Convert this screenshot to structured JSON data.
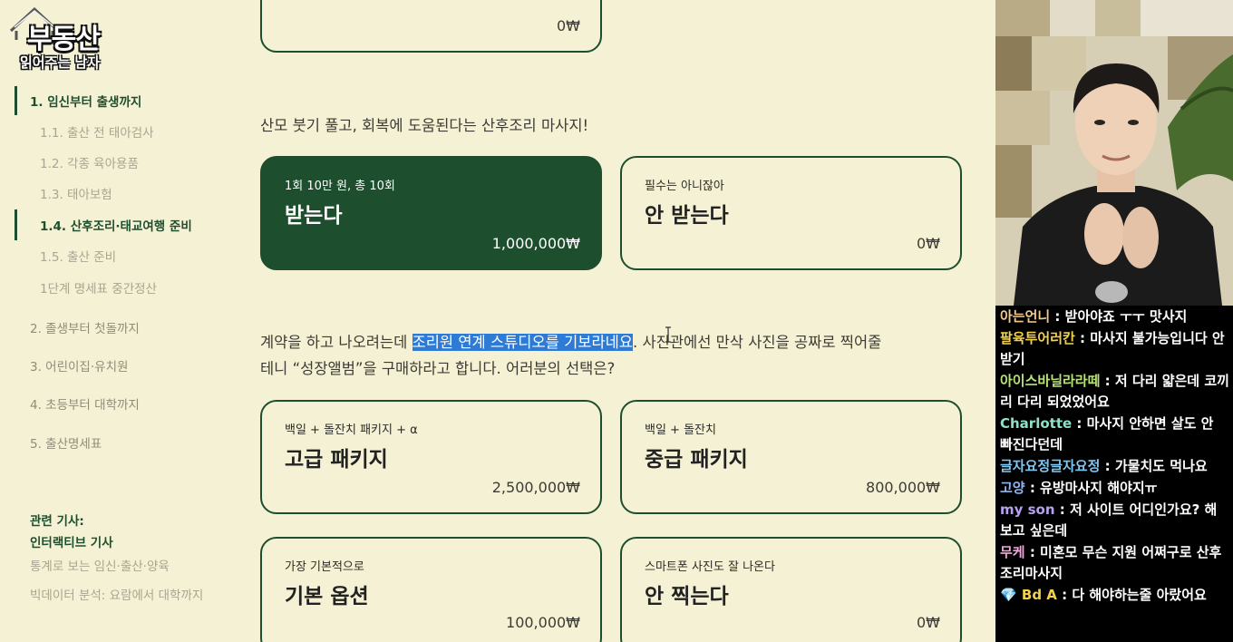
{
  "logo": {
    "line1": "부동산",
    "line2": "읽어주는 남자"
  },
  "nav": {
    "items": [
      {
        "label": "1. 임신부터 출생까지",
        "level": "main",
        "active": true
      },
      {
        "label": "1.1. 출산 전 태아검사",
        "level": "sub",
        "active": false
      },
      {
        "label": "1.2. 각종 육아용품",
        "level": "sub",
        "active": false
      },
      {
        "label": "1.3. 태아보험",
        "level": "sub",
        "active": false
      },
      {
        "label": "1.4. 산후조리·태교여행 준비",
        "level": "sub",
        "active": true
      },
      {
        "label": "1.5. 출산 준비",
        "level": "sub",
        "active": false
      },
      {
        "label": "1단계 명세표 중간정산",
        "level": "sub",
        "active": false
      },
      {
        "label": "2. 졸생부터 첫돌까지",
        "level": "main",
        "active": false
      },
      {
        "label": "3. 어린이집·유치원",
        "level": "main",
        "active": false
      },
      {
        "label": "4. 초등부터 대학까지",
        "level": "main",
        "active": false
      },
      {
        "label": "5. 출산명세표",
        "level": "main",
        "active": false
      }
    ]
  },
  "related": {
    "title": "관련 기사:",
    "links": [
      "인터랙티브 기사",
      "통계로 보는 임신·출산·양육",
      "빅데이터 분석: 요람에서 대학까지"
    ]
  },
  "top_card": {
    "price": "0₩"
  },
  "question1": {
    "text": "산모 붓기 풀고, 회복에 도움된다는 산후조리 마사지!"
  },
  "cards1": [
    {
      "sub": "1회 10만 원, 총 10회",
      "title": "받는다",
      "price": "1,000,000₩",
      "selected": true
    },
    {
      "sub": "필수는 아니잖아",
      "title": "안 받는다",
      "price": "0₩",
      "selected": false
    }
  ],
  "question2": {
    "before": "계약을 하고 나오려는데 ",
    "highlight": "조리원 연계 스튜디오를 기보라네요",
    "after": ". 사진관에선 만삭 사진을 공짜로 찍어줄",
    "line2": "테니 “성장앨범”을 구매하라고 합니다. 어러분의 선택은?"
  },
  "cards2": [
    {
      "sub": "백일 + 돌잔치 패키지 + α",
      "title": "고급 패키지",
      "price": "2,500,000₩",
      "selected": false
    },
    {
      "sub": "백일 + 돌잔치",
      "title": "중급 패키지",
      "price": "800,000₩",
      "selected": false
    },
    {
      "sub": "가장 기본적으로",
      "title": "기본 옵션",
      "price": "100,000₩",
      "selected": false
    },
    {
      "sub": "스마트폰 사진도 잘 나온다",
      "title": "안 찍는다",
      "price": "0₩",
      "selected": false
    }
  ],
  "chat": {
    "messages": [
      {
        "user": "아는언니",
        "text": " : 받아야죠 ㅜㅜ 맛사지",
        "color": "#f5c98a"
      },
      {
        "user": "팔육투어러칸",
        "text": " : 마사지 불가능입니다 안받기",
        "color": "#f3d24a"
      },
      {
        "user": "아이스바닐라라떼",
        "text": " : 저 다리 얇은데 코끼리 다리 되었었어요",
        "color": "#b6e37a"
      },
      {
        "user": "Charlotte",
        "text": " : 마사지 안하면 살도 안 빠진다던데",
        "color": "#8fe0c8"
      },
      {
        "user": "글자요정글자요정",
        "text": " : 가물치도 먹나요",
        "color": "#7fc6f0"
      },
      {
        "user": "고양",
        "text": " : 유방마사지 해야지ㅠ",
        "color": "#8fb6f5"
      },
      {
        "user": "my son",
        "text": " : 저 사이트 어디인가요? 해보고 싶은데",
        "color": "#b8a0f0"
      },
      {
        "user": "무케",
        "text": " : 미혼모 무슨 지원 어쩌구로 산후조리마사지",
        "color": "#f0a6d8"
      },
      {
        "user": "💎 Bd A",
        "text": " : 다 해야하는줄 아랐어요",
        "color": "#f3d24a"
      }
    ]
  },
  "colors": {
    "accent": "#1d4f2e",
    "background": "#f5f1d4",
    "highlight": "#2e7bd6"
  }
}
